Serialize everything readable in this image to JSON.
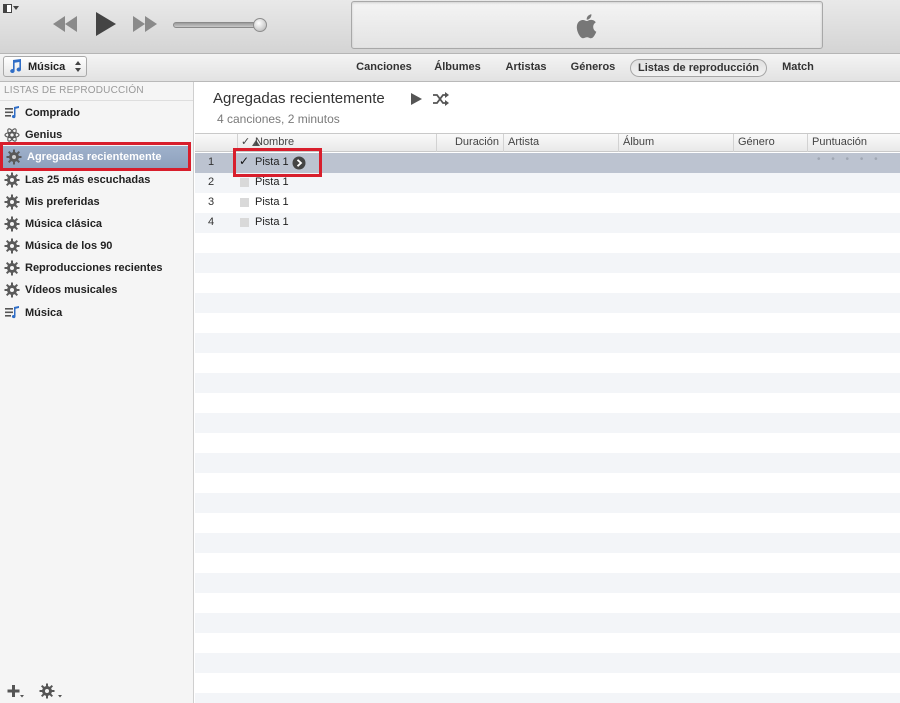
{
  "window": {
    "apple_logo": "apple-logo-icon"
  },
  "player": {
    "controls": [
      "rewind",
      "play",
      "forward"
    ],
    "volume_level": 0.92
  },
  "nav": {
    "library_label": "Música",
    "tabs": [
      {
        "label": "Canciones",
        "active": false
      },
      {
        "label": "Álbumes",
        "active": false
      },
      {
        "label": "Artistas",
        "active": false
      },
      {
        "label": "Géneros",
        "active": false
      },
      {
        "label": "Listas de reproducción",
        "active": true
      },
      {
        "label": "Match",
        "active": false
      }
    ]
  },
  "sidebar": {
    "header": "LISTAS DE REPRODUCCIÓN",
    "items": [
      {
        "label": "Comprado",
        "icon": "playlist-icon",
        "selected": false
      },
      {
        "label": "Genius",
        "icon": "genius-icon",
        "selected": false
      },
      {
        "label": "Agregadas recientemente",
        "icon": "smart-playlist-gear-icon",
        "selected": true
      },
      {
        "label": "Las 25 más escuchadas",
        "icon": "smart-playlist-gear-icon",
        "selected": false
      },
      {
        "label": "Mis preferidas",
        "icon": "smart-playlist-gear-icon",
        "selected": false
      },
      {
        "label": "Música clásica",
        "icon": "smart-playlist-gear-icon",
        "selected": false
      },
      {
        "label": "Música de los 90",
        "icon": "smart-playlist-gear-icon",
        "selected": false
      },
      {
        "label": "Reproducciones recientes",
        "icon": "smart-playlist-gear-icon",
        "selected": false
      },
      {
        "label": "Vídeos musicales",
        "icon": "smart-playlist-gear-icon",
        "selected": false
      },
      {
        "label": "Música",
        "icon": "playlist-icon",
        "selected": false
      }
    ]
  },
  "main": {
    "title": "Agregadas recientemente",
    "summary": "4 canciones, 2 minutos",
    "columns": {
      "check": "✓",
      "name": "Nombre",
      "duration": "Duración",
      "artist": "Artista",
      "album": "Álbum",
      "genre": "Género",
      "rating": "Puntuación"
    },
    "rows": [
      {
        "num": "1",
        "checked": true,
        "name": "Pista 1",
        "rating": "• • • • •",
        "selected": true
      },
      {
        "num": "2",
        "checked": false,
        "name": "Pista 1"
      },
      {
        "num": "3",
        "checked": false,
        "name": "Pista 1"
      },
      {
        "num": "4",
        "checked": false,
        "name": "Pista 1"
      }
    ]
  },
  "colors": {
    "highlight_red": "#d81e2c",
    "selection_blue": "#8ea1bd",
    "selected_row": "#bcc3d0"
  }
}
